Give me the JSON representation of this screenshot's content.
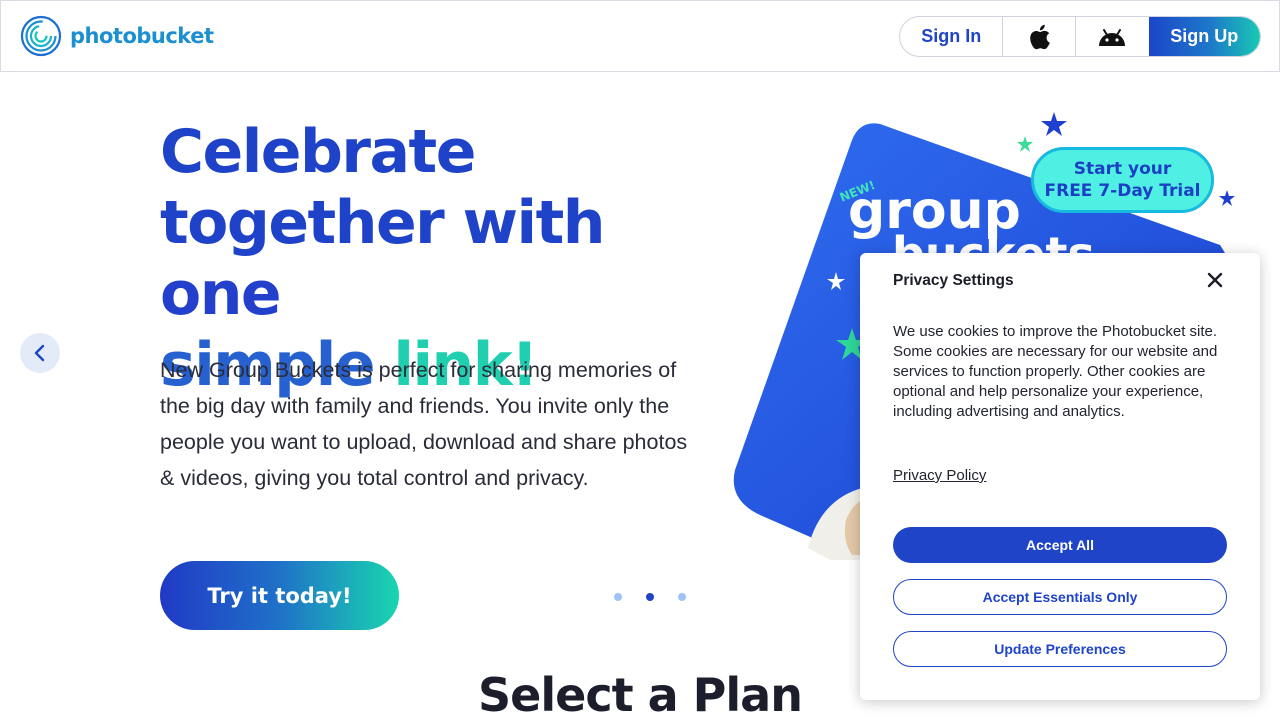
{
  "header": {
    "logo_text": "photobucket",
    "sign_in": "Sign In",
    "sign_up": "Sign Up",
    "apple_icon": "apple-icon",
    "android_icon": "android-icon"
  },
  "hero": {
    "title_line1": "Celebrate",
    "title_line2a": "together with ",
    "title_line2b": "one",
    "title_line3a": "simple ",
    "title_line3b": "link!",
    "body": "New Group Buckets is perfect for sharing memories of the big day with family and friends. You invite only the people you want to upload, download and share photos & videos, giving you total control and privacy.",
    "cta": "Try it today!",
    "slide_count": 3,
    "active_slide": 2
  },
  "promo": {
    "new_tag": "NEW!",
    "product_word1": "group",
    "product_word2": "buckets",
    "trial_line1": "Start your",
    "trial_line2": "FREE 7-Day Trial"
  },
  "section": {
    "title": "Select a Plan"
  },
  "privacy": {
    "title": "Privacy Settings",
    "body": "We use cookies to improve the Photobucket site. Some cookies are necessary for our website and services to function properly. Other cookies are optional and help personalize your experience, including advertising and analytics.",
    "policy_link": "Privacy Policy",
    "accept_all": "Accept All",
    "accept_essentials": "Accept Essentials Only",
    "update_preferences": "Update Preferences"
  },
  "colors": {
    "brand_blue": "#1f44c8",
    "brand_teal": "#19d5b0",
    "logo_blue": "#1b8fcf"
  }
}
